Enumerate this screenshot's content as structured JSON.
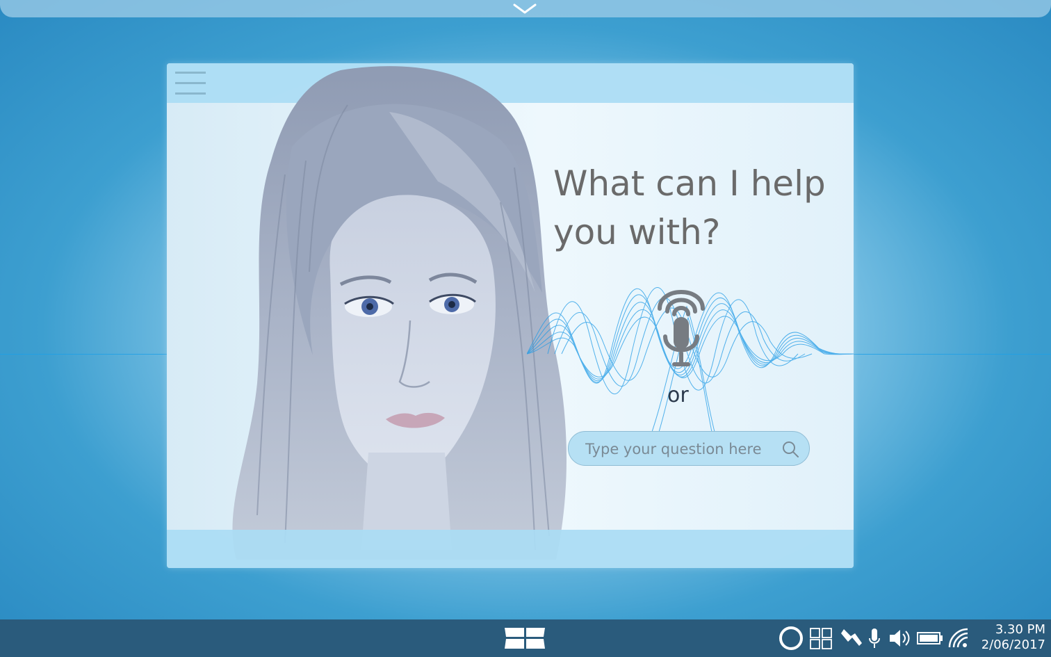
{
  "prompt": {
    "line1": "What can I help",
    "line2": "you with?"
  },
  "or_label": "or",
  "search": {
    "placeholder": "Type your question here"
  },
  "taskbar": {
    "time": "3.30 PM",
    "date": "2/06/2017"
  },
  "icons": {
    "pull_down": "chevron-down-icon",
    "menu": "hamburger-icon",
    "mic": "microphone-icon",
    "search": "search-icon",
    "start": "windows-logo-icon",
    "assistant": "circle-icon",
    "task_view": "grid-icon",
    "touch": "hand-icon",
    "microphone": "microphone-icon",
    "volume": "speaker-icon",
    "battery": "battery-icon",
    "wifi": "wifi-icon"
  },
  "colors": {
    "accent": "#2a8ac2",
    "taskbar": "#2a5b7c",
    "wave": "#1e9ae6"
  }
}
